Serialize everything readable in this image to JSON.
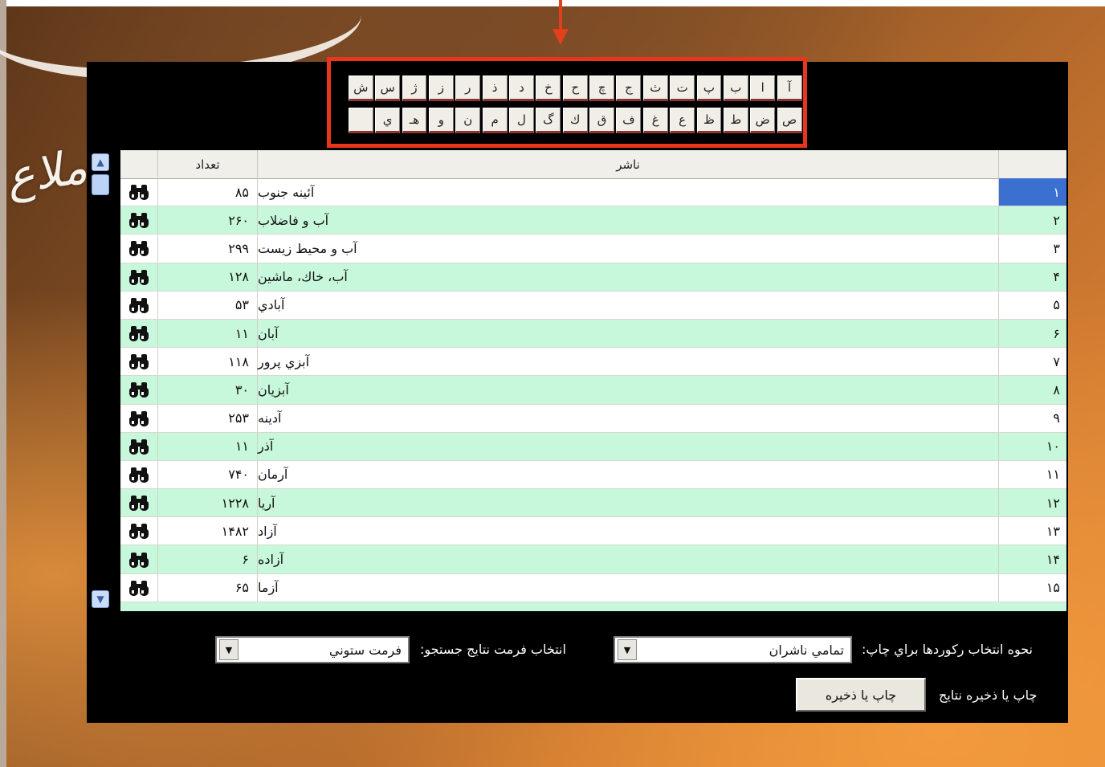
{
  "background": {
    "script_text": "ملاع"
  },
  "colors": {
    "highlight_border": "#e8361c",
    "row_alt": "#c8f8dc",
    "selected_index": "#3b6fd0"
  },
  "alphabet": {
    "row1": [
      "آ",
      "ا",
      "ب",
      "پ",
      "ت",
      "ث",
      "ج",
      "چ",
      "ح",
      "خ",
      "د",
      "ذ",
      "ر",
      "ز",
      "ژ",
      "س",
      "ش"
    ],
    "row2": [
      "ص",
      "ض",
      "ط",
      "ظ",
      "ع",
      "غ",
      "ف",
      "ق",
      "ك",
      "گ",
      "ل",
      "م",
      "ن",
      "و",
      "هـ",
      "ي",
      ""
    ]
  },
  "table": {
    "headers": {
      "publisher": "ناشر",
      "count": "تعداد"
    },
    "rows": [
      {
        "idx": "۱",
        "name": "آئينه جنوب",
        "count": "۸۵"
      },
      {
        "idx": "۲",
        "name": "آب و فاضلاب",
        "count": "۲۶۰"
      },
      {
        "idx": "۳",
        "name": "آب و محيط زيست",
        "count": "۲۹۹"
      },
      {
        "idx": "۴",
        "name": "آب، خاك، ماشين",
        "count": "۱۲۸"
      },
      {
        "idx": "۵",
        "name": "آبادي",
        "count": "۵۳"
      },
      {
        "idx": "۶",
        "name": "آبان",
        "count": "۱۱"
      },
      {
        "idx": "۷",
        "name": "آبزي پرور",
        "count": "۱۱۸"
      },
      {
        "idx": "۸",
        "name": "آبزيان",
        "count": "۳۰"
      },
      {
        "idx": "۹",
        "name": "آدينه",
        "count": "۲۵۳"
      },
      {
        "idx": "۱۰",
        "name": "آذر",
        "count": "۱۱"
      },
      {
        "idx": "۱۱",
        "name": "آرمان",
        "count": "۷۴۰"
      },
      {
        "idx": "۱۲",
        "name": "آريا",
        "count": "۱۲۲۸"
      },
      {
        "idx": "۱۳",
        "name": "آزاد",
        "count": "۱۴۸۲"
      },
      {
        "idx": "۱۴",
        "name": "آزاده",
        "count": "۶"
      },
      {
        "idx": "۱۵",
        "name": "آزما",
        "count": "۶۵"
      }
    ],
    "row_button_icon": "binoculars-icon"
  },
  "controls": {
    "record_selection_label": "نحوه انتخاب ركوردها براي چاپ:",
    "record_selection_value": "تمامي ناشران",
    "format_label": "انتخاب فرمت نتايج جستجو:",
    "format_value": "فرمت ستوني",
    "print_save_label": "چاپ يا ذخيره نتايج",
    "print_save_button": "چاپ يا ذخيره"
  }
}
